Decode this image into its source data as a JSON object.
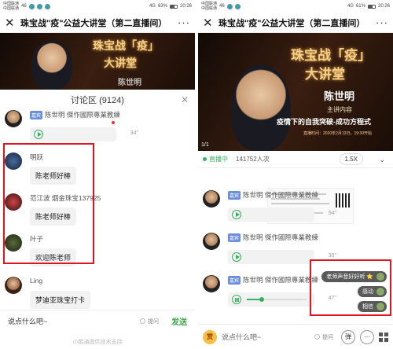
{
  "status_left": {
    "carrier_top": "中国联通",
    "carrier_bottom": "中国联通",
    "signal": "46",
    "net": "4G",
    "battery": "63%",
    "time": "20:26"
  },
  "status_right": {
    "carrier_top": "中国联通",
    "carrier_bottom": "中国联通",
    "signal": "46",
    "net": "4G",
    "battery": "61%",
    "time": "20:26"
  },
  "title": "珠宝战\"疫\"公益大讲堂（第二直播间）",
  "banner": {
    "title_line1": "珠宝战「疫」",
    "title_line2": "大讲堂",
    "speaker": "陈世明",
    "subtitle": "主讲内容",
    "topic": "疫情下的自我突破-成功方程式",
    "date": "直播时间：2020年2月13日，19:30开始",
    "page": "1/1"
  },
  "discussion": {
    "header": "讨论区 (9124)",
    "messages": [
      {
        "tag": "嘉宾",
        "name": "陈世明 傑作國際專業教練",
        "voice_duration": "34\""
      },
      {
        "name": "明跃",
        "text": "陈老师好棒"
      },
      {
        "name": "范江波 烟金珠宝137925",
        "text": "陈老师好棒"
      },
      {
        "name": "叶子",
        "text": "欢迎陈老师"
      },
      {
        "name": "Ling",
        "text": "梦迪亚珠宝打卡"
      }
    ],
    "input_placeholder": "说点什么吧~",
    "ask_label": "提问",
    "send_label": "发送",
    "footer": "小鹅通提供技术支持"
  },
  "live": {
    "status": "直播中",
    "views": "141752人次",
    "rate": "1.5X",
    "messages": [
      {
        "tag": "嘉宾",
        "name": "陈世明 傑作國際專業教練",
        "voice_duration": "54\""
      },
      {
        "tag": "嘉宾",
        "name": "陈世明 傑作國際專業教練",
        "voice_duration": "30\""
      },
      {
        "tag": "嘉宾",
        "name": "陈世明 傑作國際專業教練",
        "voice_duration": "47\""
      }
    ],
    "comments": [
      "老师声音好好听 ⭐",
      "感动",
      "相信"
    ],
    "input_placeholder": "说点什么吧~",
    "ask_label": "提问",
    "reward_label": "赏",
    "bullet_label": "弹",
    "more_label": "···"
  },
  "progress_fraction": 0.25
}
